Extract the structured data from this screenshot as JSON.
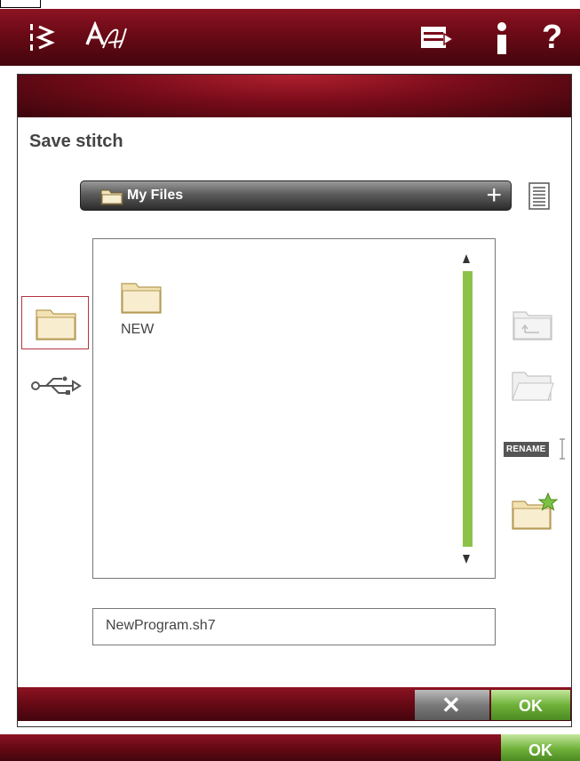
{
  "toolbar": {
    "icons": [
      "stitch-menu-icon",
      "font-icon",
      "file-manager-icon",
      "info-icon",
      "help-icon"
    ],
    "help_label": "?"
  },
  "dialog": {
    "title": "Save stitch",
    "path": {
      "label": "My Files",
      "add_folder_symbol": "+"
    },
    "items": [
      {
        "name": "NEW",
        "type": "folder"
      }
    ],
    "filename_value": "NewProgram.sh7",
    "rename_label": "RENAME",
    "cancel_symbol": "✕",
    "ok_label": "OK"
  },
  "bottom_bar": {
    "ok_label": "OK"
  },
  "colors": {
    "brand_red": "#7a0c1a",
    "scroll_green": "#8dc24a",
    "ok_green": "#6fb13a"
  }
}
